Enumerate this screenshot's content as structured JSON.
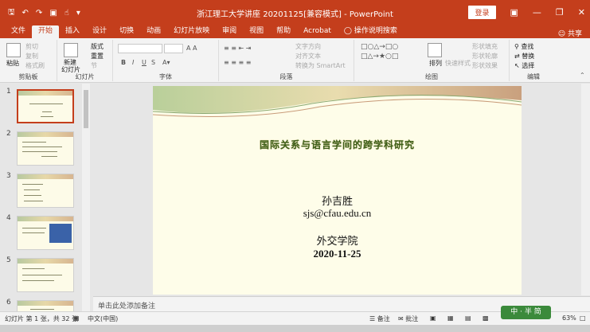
{
  "app": {
    "window_title": "浙江理工大学讲座  20201125[兼容模式] - PowerPoint",
    "login_label": "登录",
    "accent_color": "#c43e1c",
    "share_label": "共享",
    "qat_icons": [
      "save-icon",
      "undo-icon",
      "redo-icon",
      "presentation-icon",
      "touch-mode-icon",
      "customize-icon"
    ]
  },
  "tabs": [
    {
      "label": "文件"
    },
    {
      "label": "开始",
      "active": true
    },
    {
      "label": "插入"
    },
    {
      "label": "设计"
    },
    {
      "label": "切换"
    },
    {
      "label": "动画"
    },
    {
      "label": "幻灯片放映"
    },
    {
      "label": "审阅"
    },
    {
      "label": "视图"
    },
    {
      "label": "帮助"
    },
    {
      "label": "Acrobat"
    },
    {
      "label": "操作说明搜索"
    }
  ],
  "ribbon": {
    "clipboard": {
      "group": "剪贴板",
      "paste": "粘贴",
      "cut": "剪切",
      "copy": "复制",
      "format_painter": "格式刷"
    },
    "slides": {
      "group": "幻灯片",
      "new_slide": "新建",
      "new_slide2": "幻灯片",
      "layout": "版式",
      "reset": "重置",
      "section": "节"
    },
    "font": {
      "group": "字体",
      "bold": "B",
      "italic": "I",
      "underline": "U",
      "strike": "S"
    },
    "paragraph": {
      "group": "段落",
      "text_direction": "文字方向",
      "align_text": "对齐文本",
      "smartart": "转换为 SmartArt"
    },
    "drawing": {
      "group": "绘图",
      "arrange": "排列",
      "quick_styles": "快速样式",
      "shape_fill": "形状填充",
      "shape_outline": "形状轮廓",
      "shape_effects": "形状效果"
    },
    "editing": {
      "group": "编辑",
      "find": "查找",
      "replace": "替换",
      "select": "选择"
    }
  },
  "thumbnails": [
    "1",
    "2",
    "3",
    "4",
    "5",
    "6"
  ],
  "slide": {
    "title": "国际关系与语言学间的跨学科研究",
    "author": "孙吉胜",
    "email": "sjs@cfau.edu.cn",
    "department": "外交学院",
    "date": "2020-11-25"
  },
  "notes_placeholder": "单击此处添加备注",
  "status": {
    "slide_info": "幻灯片 第 1 张，共 32 张",
    "language": "中文(中国)",
    "notes": "备注",
    "comments": "批注",
    "zoom": "63%",
    "badge": "中 · 半 简"
  }
}
